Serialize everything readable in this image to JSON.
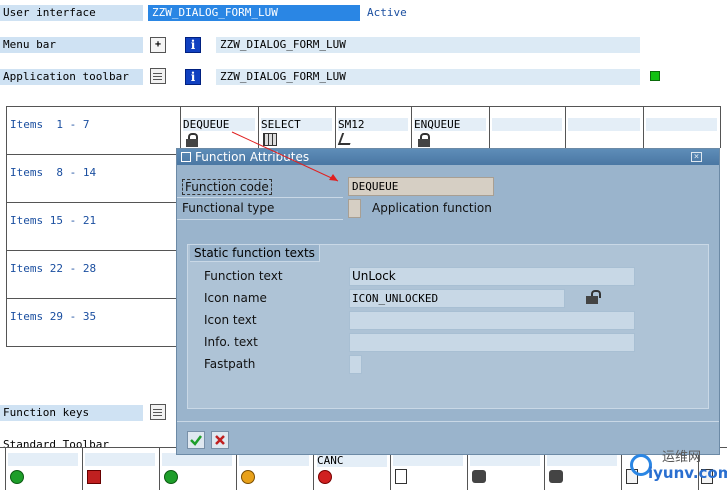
{
  "header": {
    "user_interface_label": "User interface",
    "program_name": "ZZW_DIALOG_FORM_LUW",
    "status": "Active",
    "menu_bar_label": "Menu bar",
    "menu_bar_value": "ZZW_DIALOG_FORM_LUW",
    "app_toolbar_label": "Application toolbar",
    "app_toolbar_value": "ZZW_DIALOG_FORM_LUW"
  },
  "items": {
    "rows": [
      "Items  1 - 7",
      "Items  8 - 14",
      "Items 15 - 21",
      "Items 22 - 28",
      "Items 29 - 35"
    ],
    "row1_cells": [
      "DEQUEUE",
      "SELECT",
      "SM12",
      "ENQUEUE",
      "",
      "",
      ""
    ]
  },
  "function_keys_label": "Function keys",
  "standard_toolbar_label": "Standard Toolbar",
  "toolbar_canc_label": "CANC",
  "dialog": {
    "title": "Function Attributes",
    "function_code_label": "Function code",
    "function_code_value": "DEQUEUE",
    "functional_type_label": "Functional type",
    "functional_type_text": "Application function",
    "group_title": "Static function texts",
    "function_text_label": "Function text",
    "function_text_value": "UnLock",
    "icon_name_label": "Icon name",
    "icon_name_value": "ICON_UNLOCKED",
    "icon_text_label": "Icon text",
    "icon_text_value": "",
    "info_text_label": "Info. text",
    "info_text_value": "",
    "fastpath_label": "Fastpath",
    "fastpath_value": ""
  },
  "watermark": {
    "site_name": "运维网",
    "url": "iyunv.com"
  },
  "colors": {
    "label_bg": "#cfe2f3",
    "active_field": "#2a86e4",
    "dialog_bg": "#9ab4cc",
    "titlebar": "#4a77a3",
    "status_green": "#11c011",
    "arrow_red": "#e02020"
  }
}
